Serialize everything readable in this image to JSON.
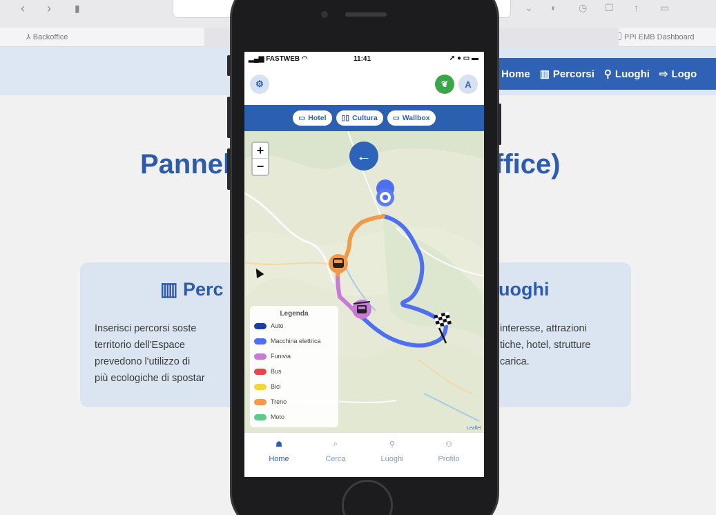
{
  "browser": {
    "bookmark_left": "Backoffice",
    "bookmark_right": "PPI EMB Dashboard"
  },
  "site": {
    "nav": [
      {
        "label": "Home",
        "icon": "home-icon"
      },
      {
        "label": "Percorsi",
        "icon": "map-icon"
      },
      {
        "label": "Luoghi",
        "icon": "pin-icon"
      },
      {
        "label": "Logo",
        "icon": "logout-icon"
      }
    ],
    "title_left": "Pannel",
    "title_right": "ffice)",
    "card_left": {
      "title": "Perc",
      "lines": [
        "Inserisci percorsi soste",
        "territorio dell'Espace",
        "prevedono l'utilizzo di",
        "più ecologiche di spostar"
      ]
    },
    "card_right": {
      "title": "uoghi",
      "lines": [
        "interesse, attrazioni",
        "tiche, hotel, strutture",
        "carica."
      ]
    }
  },
  "phone": {
    "status": {
      "carrier": "FASTWEB",
      "time": "11:41"
    },
    "avatar_letter": "A",
    "filters": [
      "Hotel",
      "Cultura",
      "Wallbox"
    ],
    "zoom": {
      "in": "+",
      "out": "−"
    },
    "legend": {
      "title": "Legenda",
      "items": [
        {
          "label": "Auto",
          "color": "#1f3d9a"
        },
        {
          "label": "Macchina elettrica",
          "color": "#4d6ff0"
        },
        {
          "label": "Funivia",
          "color": "#c77ad6"
        },
        {
          "label": "Bus",
          "color": "#e04a4a"
        },
        {
          "label": "Bici",
          "color": "#f2d63a"
        },
        {
          "label": "Treno",
          "color": "#f09a4a"
        },
        {
          "label": "Moto",
          "color": "#5fc98a"
        }
      ]
    },
    "attribution": "Leaflet",
    "bottom_nav": [
      {
        "label": "Home",
        "icon": "home-icon",
        "active": true
      },
      {
        "label": "Cerca",
        "icon": "search-icon",
        "active": false
      },
      {
        "label": "Luoghi",
        "icon": "pin-icon",
        "active": false
      },
      {
        "label": "Profilo",
        "icon": "user-icon",
        "active": false
      }
    ]
  },
  "colors": {
    "brand_blue": "#2b5fb0",
    "route_electric": "#4d6ff0",
    "route_train": "#f09a4a",
    "route_cable": "#c77ad6"
  }
}
